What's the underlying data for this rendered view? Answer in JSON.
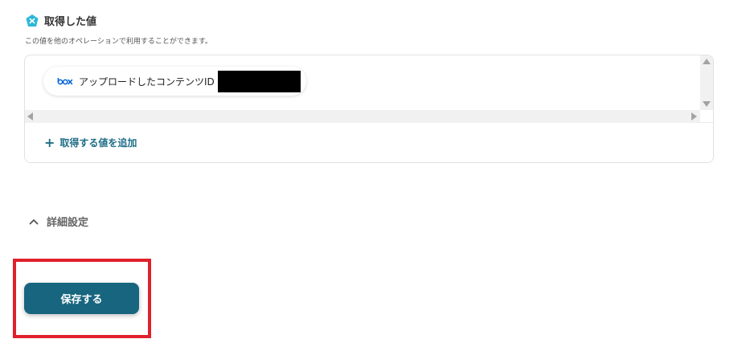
{
  "section": {
    "title": "取得した値",
    "description": "この値を他のオペレーションで利用することができます。"
  },
  "values": {
    "items": [
      {
        "label": "アップロードしたコンテンツID",
        "redacted": true,
        "icon": "box-logo"
      }
    ],
    "add_label": "取得する値を追加"
  },
  "advanced": {
    "label": "詳細設定",
    "expanded": true
  },
  "actions": {
    "save_label": "保存する"
  },
  "colors": {
    "accent": "#1f6e86",
    "save_button": "#17657f",
    "highlight": "#e0202a",
    "box_brand": "#0061d5",
    "yoom_icon": "#2bb7d6"
  }
}
